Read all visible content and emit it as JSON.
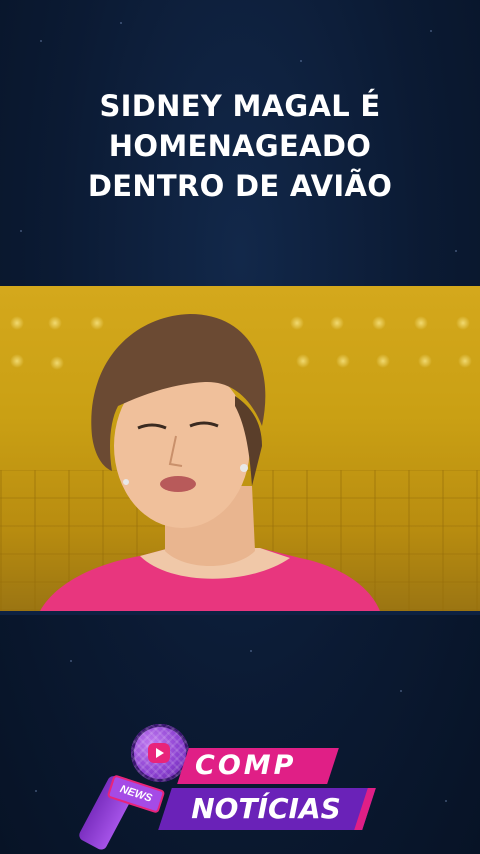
{
  "headline": {
    "line1": "SIDNEY MAGAL É",
    "line2": "HOMENAGEADO",
    "line3": "DENTRO DE AVIÃO"
  },
  "video": {
    "description_visible": false
  },
  "logo": {
    "word1": "COMP",
    "word2": "NOTÍCIAS",
    "tag": "NEWS",
    "colors": {
      "pink": "#e01f86",
      "purple": "#6a22b8",
      "violet": "#a54be6"
    },
    "icons": [
      "microphone-icon",
      "play-icon"
    ]
  },
  "colors": {
    "background": "#0b1a33",
    "video_backdrop": "#caa014",
    "headline_text": "#ffffff"
  }
}
